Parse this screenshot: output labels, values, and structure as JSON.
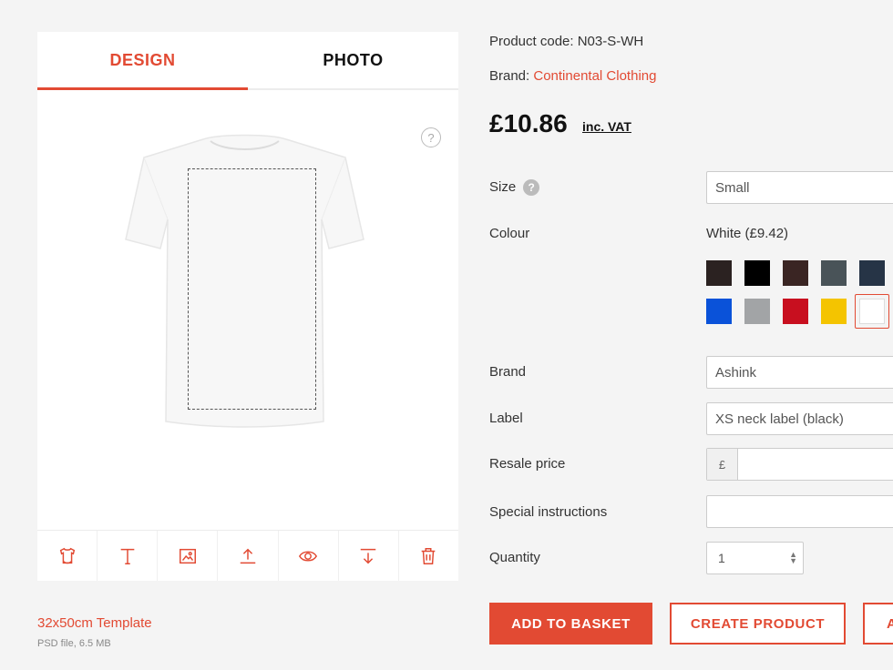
{
  "tabs": {
    "design": "DESIGN",
    "photo": "PHOTO"
  },
  "help_symbol": "?",
  "template": {
    "link": "32x50cm Template",
    "meta": "PSD file, 6.5 MB"
  },
  "product": {
    "code": "Product code: N03-S-WH",
    "brand_prefix": "Brand: ",
    "brand_name": "Continental Clothing",
    "price": "£10.86",
    "price_suffix": "inc. VAT"
  },
  "form": {
    "size_label": "Size",
    "size_value": "Small",
    "colour_label": "Colour",
    "colour_value": "White (£9.42)",
    "brand_label": "Brand",
    "brand_value": "Ashink",
    "label_label": "Label",
    "label_value": "XS neck label (black)",
    "resale_label": "Resale price",
    "currency_symbol": "£",
    "special_label": "Special instructions",
    "quantity_label": "Quantity",
    "quantity_value": "1"
  },
  "swatches_row1": [
    "#2b2221",
    "#000000",
    "#3a2523",
    "#495358",
    "#263446"
  ],
  "swatches_row2": [
    "#0a52d9",
    "#a2a4a6",
    "#c80f1f",
    "#f4c400",
    "#ffffff"
  ],
  "buttons": {
    "add_to_basket": "ADD TO BASKET",
    "create_product": "CREATE PRODUCT",
    "third": "A"
  },
  "accent": "#e24a33",
  "icons": [
    "shirt-icon",
    "text-icon",
    "image-icon",
    "upload-icon",
    "eye-icon",
    "download-icon",
    "trash-icon"
  ]
}
